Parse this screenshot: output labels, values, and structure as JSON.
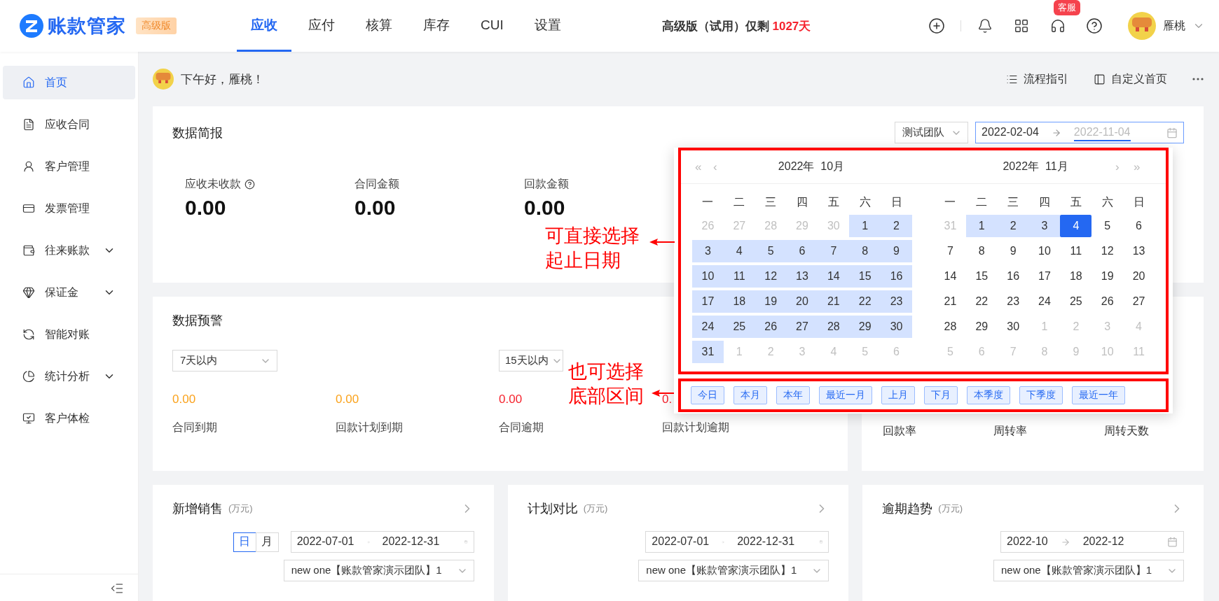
{
  "header": {
    "logo": "账款管家",
    "edition_badge": "高级版",
    "tabs": [
      {
        "label": "应收",
        "selected": true
      },
      {
        "label": "应付",
        "selected": false
      },
      {
        "label": "核算",
        "selected": false
      },
      {
        "label": "库存",
        "selected": false
      },
      {
        "label": "CUI",
        "selected": false
      },
      {
        "label": "设置",
        "selected": false
      }
    ],
    "trial": {
      "text": "高级版（试用）仅剩",
      "days": "1027天"
    },
    "service_badge": "客服",
    "user": "雁桃"
  },
  "sidebar": {
    "items": [
      {
        "label": "首页",
        "selected": true,
        "has_submenu": false
      },
      {
        "label": "应收合同",
        "selected": false,
        "has_submenu": false
      },
      {
        "label": "客户管理",
        "selected": false,
        "has_submenu": false
      },
      {
        "label": "发票管理",
        "selected": false,
        "has_submenu": false
      },
      {
        "label": "往来账款",
        "selected": false,
        "has_submenu": true
      },
      {
        "label": "保证金",
        "selected": false,
        "has_submenu": true
      },
      {
        "label": "智能对账",
        "selected": false,
        "has_submenu": false
      },
      {
        "label": "统计分析",
        "selected": false,
        "has_submenu": true
      },
      {
        "label": "客户体检",
        "selected": false,
        "has_submenu": false
      }
    ]
  },
  "greeting": {
    "text": "下午好，雁桃！",
    "actions": [
      "流程指引",
      "自定义首页"
    ]
  },
  "summary": {
    "title": "数据简报",
    "team": "测试团队",
    "date_start": "2022-02-04",
    "date_end": "2022-11-04",
    "end_focused": true,
    "metrics": [
      {
        "label": "应收未收款",
        "help": true,
        "value": "0.00"
      },
      {
        "label": "合同金额",
        "value": "0.00"
      },
      {
        "label": "回款金额",
        "value": "0.00"
      }
    ]
  },
  "warning": {
    "title": "数据预警",
    "selects": [
      "7天以内",
      "15天以内"
    ],
    "items": [
      {
        "value": "0.00",
        "label": "合同到期",
        "color": "#faa21b"
      },
      {
        "value": "0.00",
        "label": "回款计划到期",
        "color": "#faa21b"
      },
      {
        "value": "0.00",
        "label": "合同逾期",
        "color": "#f5222d"
      },
      {
        "value": "0.",
        "label": "回款计划逾期",
        "color": "#f5222d"
      }
    ]
  },
  "rates": {
    "labels": [
      "回款率",
      "周转率",
      "周转天数"
    ]
  },
  "charts": [
    {
      "title": "新增销售",
      "unit": "(万元)",
      "toggle": [
        {
          "label": "日",
          "selected": true
        },
        {
          "label": "月",
          "selected": false
        }
      ],
      "start": "2022-07-01",
      "end": "2022-12-31",
      "team": "new one【账款管家演示团队】1"
    },
    {
      "title": "计划对比",
      "unit": "(万元)",
      "start": "2022-07-01",
      "end": "2022-12-31",
      "team": "new one【账款管家演示团队】1"
    },
    {
      "title": "逾期趋势",
      "unit": "(万元)",
      "start": "2022-10",
      "end": "2022-12",
      "team": "new one【账款管家演示团队】1"
    }
  ],
  "calendar": {
    "months": [
      {
        "title": "2022年  10月",
        "weekdays": [
          "一",
          "二",
          "三",
          "四",
          "五",
          "六",
          "日"
        ],
        "weeks": [
          [
            {
              "d": "26",
              "kind": "other"
            },
            {
              "d": "27",
              "kind": "other"
            },
            {
              "d": "28",
              "kind": "other"
            },
            {
              "d": "29",
              "kind": "other"
            },
            {
              "d": "30",
              "kind": "other"
            },
            {
              "d": "1",
              "kind": "range"
            },
            {
              "d": "2",
              "kind": "range"
            }
          ],
          [
            {
              "d": "3",
              "kind": "range"
            },
            {
              "d": "4",
              "kind": "range"
            },
            {
              "d": "5",
              "kind": "range"
            },
            {
              "d": "6",
              "kind": "range"
            },
            {
              "d": "7",
              "kind": "range"
            },
            {
              "d": "8",
              "kind": "range"
            },
            {
              "d": "9",
              "kind": "range"
            }
          ],
          [
            {
              "d": "10",
              "kind": "range"
            },
            {
              "d": "11",
              "kind": "range"
            },
            {
              "d": "12",
              "kind": "range"
            },
            {
              "d": "13",
              "kind": "range"
            },
            {
              "d": "14",
              "kind": "range"
            },
            {
              "d": "15",
              "kind": "range"
            },
            {
              "d": "16",
              "kind": "range"
            }
          ],
          [
            {
              "d": "17",
              "kind": "range"
            },
            {
              "d": "18",
              "kind": "range"
            },
            {
              "d": "19",
              "kind": "range"
            },
            {
              "d": "20",
              "kind": "range"
            },
            {
              "d": "21",
              "kind": "range"
            },
            {
              "d": "22",
              "kind": "range"
            },
            {
              "d": "23",
              "kind": "range"
            }
          ],
          [
            {
              "d": "24",
              "kind": "range"
            },
            {
              "d": "25",
              "kind": "range"
            },
            {
              "d": "26",
              "kind": "range"
            },
            {
              "d": "27",
              "kind": "range"
            },
            {
              "d": "28",
              "kind": "range"
            },
            {
              "d": "29",
              "kind": "range"
            },
            {
              "d": "30",
              "kind": "range"
            }
          ],
          [
            {
              "d": "31",
              "kind": "range"
            },
            {
              "d": "1",
              "kind": "other"
            },
            {
              "d": "2",
              "kind": "other"
            },
            {
              "d": "3",
              "kind": "other"
            },
            {
              "d": "4",
              "kind": "other"
            },
            {
              "d": "5",
              "kind": "other"
            },
            {
              "d": "6",
              "kind": "other"
            }
          ]
        ]
      },
      {
        "title": "2022年  11月",
        "weekdays": [
          "一",
          "二",
          "三",
          "四",
          "五",
          "六",
          "日"
        ],
        "weeks": [
          [
            {
              "d": "31",
              "kind": "other"
            },
            {
              "d": "1",
              "kind": "range"
            },
            {
              "d": "2",
              "kind": "range"
            },
            {
              "d": "3",
              "kind": "range"
            },
            {
              "d": "4",
              "kind": "selected"
            },
            {
              "d": "5",
              "kind": "normal"
            },
            {
              "d": "6",
              "kind": "normal"
            }
          ],
          [
            {
              "d": "7",
              "kind": "normal"
            },
            {
              "d": "8",
              "kind": "normal"
            },
            {
              "d": "9",
              "kind": "normal"
            },
            {
              "d": "10",
              "kind": "normal"
            },
            {
              "d": "11",
              "kind": "normal"
            },
            {
              "d": "12",
              "kind": "normal"
            },
            {
              "d": "13",
              "kind": "normal"
            }
          ],
          [
            {
              "d": "14",
              "kind": "normal"
            },
            {
              "d": "15",
              "kind": "normal"
            },
            {
              "d": "16",
              "kind": "normal"
            },
            {
              "d": "17",
              "kind": "normal"
            },
            {
              "d": "18",
              "kind": "normal"
            },
            {
              "d": "19",
              "kind": "normal"
            },
            {
              "d": "20",
              "kind": "normal"
            }
          ],
          [
            {
              "d": "21",
              "kind": "normal"
            },
            {
              "d": "22",
              "kind": "normal"
            },
            {
              "d": "23",
              "kind": "normal"
            },
            {
              "d": "24",
              "kind": "normal"
            },
            {
              "d": "25",
              "kind": "normal"
            },
            {
              "d": "26",
              "kind": "normal"
            },
            {
              "d": "27",
              "kind": "normal"
            }
          ],
          [
            {
              "d": "28",
              "kind": "normal"
            },
            {
              "d": "29",
              "kind": "normal"
            },
            {
              "d": "30",
              "kind": "normal"
            },
            {
              "d": "1",
              "kind": "other"
            },
            {
              "d": "2",
              "kind": "other"
            },
            {
              "d": "3",
              "kind": "other"
            },
            {
              "d": "4",
              "kind": "other"
            }
          ],
          [
            {
              "d": "5",
              "kind": "other"
            },
            {
              "d": "6",
              "kind": "other"
            },
            {
              "d": "7",
              "kind": "other"
            },
            {
              "d": "8",
              "kind": "other"
            },
            {
              "d": "9",
              "kind": "other"
            },
            {
              "d": "10",
              "kind": "other"
            },
            {
              "d": "11",
              "kind": "other"
            }
          ]
        ]
      }
    ],
    "nav": [
      "«",
      "‹",
      "›",
      "»"
    ],
    "shortcuts": [
      "今日",
      "本月",
      "本年",
      "最近一月",
      "上月",
      "下月",
      "本季度",
      "下季度",
      "最近一年"
    ]
  },
  "annotations": [
    {
      "lines": [
        "可直接选择",
        "起止日期"
      ]
    },
    {
      "lines": [
        "也可选择",
        "底部区间"
      ]
    }
  ]
}
